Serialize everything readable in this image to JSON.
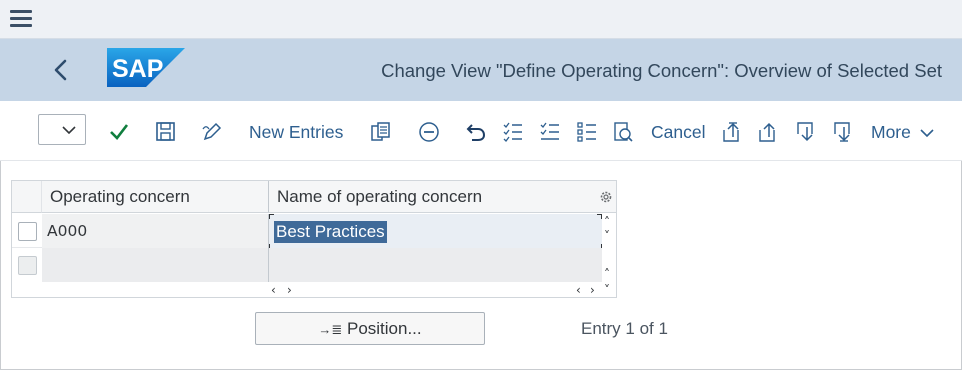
{
  "header": {
    "title": "Change View \"Define Operating Concern\": Overview of Selected Set",
    "logo_text": "SAP",
    "brand_color": "#1a73c8"
  },
  "menubar": {
    "menu_icon": "hamburger-menu-icon"
  },
  "toolbar": {
    "select_value": "",
    "new_entries_label": "New Entries",
    "cancel_label": "Cancel",
    "more_label": "More",
    "icons": [
      "check-icon",
      "save-icon",
      "edit-icon",
      "copy-icon",
      "delete-icon",
      "undo-icon",
      "select-all-icon",
      "deselect-all-icon",
      "select-block-icon",
      "print-icon",
      "first-page-icon",
      "previous-page-icon",
      "next-page-icon",
      "last-page-icon"
    ]
  },
  "table": {
    "columns": [
      "Operating concern",
      "Name of operating concern"
    ],
    "rows": [
      {
        "operating_concern": "A000",
        "name": "Best Practices"
      },
      {
        "operating_concern": "",
        "name": ""
      }
    ]
  },
  "footer": {
    "position_button": "Position...",
    "entry_status": "Entry 1 of 1"
  },
  "colors": {
    "header_bg": "#c5d5e6",
    "accent": "#2e5f8f",
    "selection": "#3f6a99"
  }
}
